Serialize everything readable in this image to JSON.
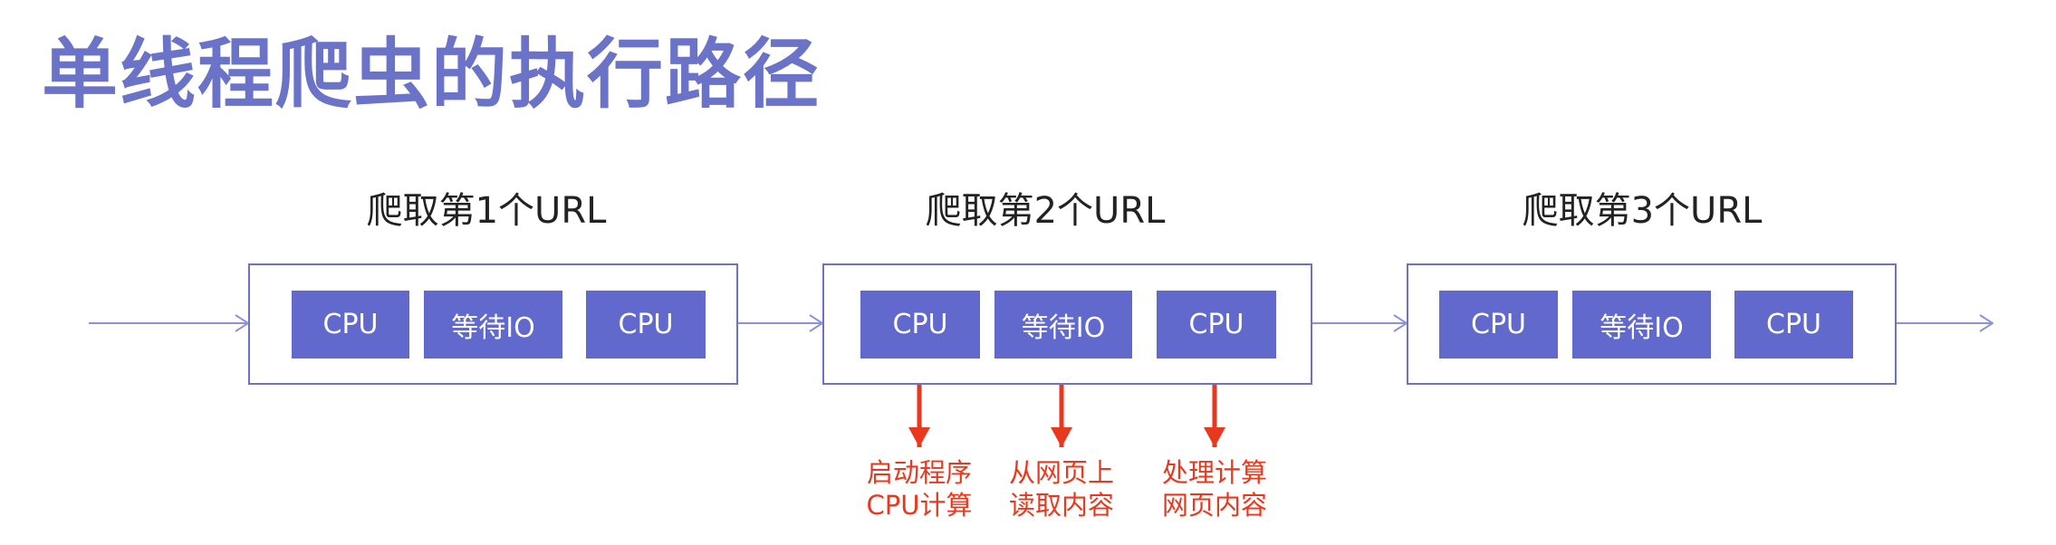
{
  "title": "单线程爬虫的执行路径",
  "groups": [
    {
      "label": "爬取第1个URL",
      "steps": [
        "CPU",
        "等待IO",
        "CPU"
      ]
    },
    {
      "label": "爬取第2个URL",
      "steps": [
        "CPU",
        "等待IO",
        "CPU"
      ]
    },
    {
      "label": "爬取第3个URL",
      "steps": [
        "CPU",
        "等待IO",
        "CPU"
      ]
    }
  ],
  "annotations": [
    {
      "line1": "启动程序",
      "line2": "CPU计算"
    },
    {
      "line1": "从网页上",
      "line2": "读取内容"
    },
    {
      "line1": "处理计算",
      "line2": "网页内容"
    }
  ],
  "colors": {
    "title": "#6b73c9",
    "step_fill": "#6269cc",
    "box_border": "#6d72c3",
    "flow_arrow": "#8d92d6",
    "annotation": "#e8391f"
  }
}
